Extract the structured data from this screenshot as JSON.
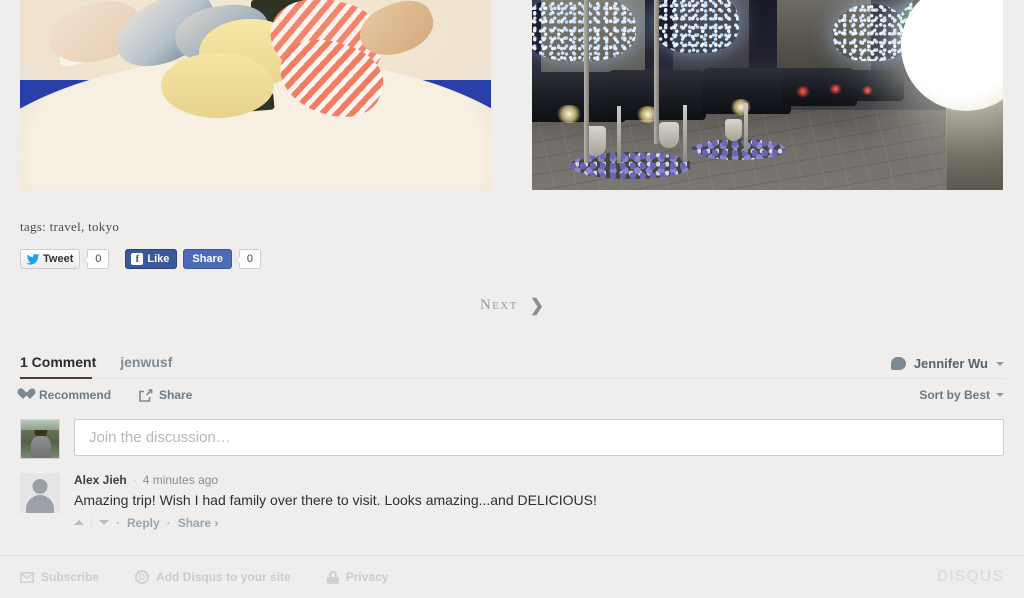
{
  "gallery": {
    "images": [
      {
        "alt": "Sushi platter on blue-and-white patterned plate",
        "name": "photo-sushi"
      },
      {
        "alt": "Tokyo street at night with illuminated trees and taxis",
        "name": "photo-street"
      }
    ]
  },
  "tags": {
    "label": "tags: travel, tokyo"
  },
  "social": {
    "tweet_label": "Tweet",
    "tweet_count": "0",
    "like_label": "Like",
    "facebook_glyph": "f",
    "share_label": "Share",
    "share_count": "0"
  },
  "pagination": {
    "next_label": "Next",
    "next_chevron": "❯"
  },
  "disqus": {
    "tabs": [
      {
        "label": "1 Comment",
        "active": true
      },
      {
        "label": "jenwusf",
        "active": false
      }
    ],
    "user": {
      "name": "Jennifer Wu",
      "icon": "speech-bubble-icon"
    },
    "actions": {
      "recommend_label": "Recommend",
      "share_label": "Share",
      "sort_label": "Sort by Best"
    },
    "compose": {
      "placeholder": "Join the discussion…",
      "value": ""
    },
    "comments": [
      {
        "author": "Alex Jieh",
        "separator": "·",
        "time": "4 minutes ago",
        "text": "Amazing trip! Wish I had family over there to visit. Looks amazing...and DELICIOUS!",
        "reply_label": "Reply",
        "share_label": "Share ›",
        "dot": "·"
      }
    ],
    "footer": {
      "subscribe_label": "Subscribe",
      "add_disqus_label": "Add Disqus to your site",
      "privacy_label": "Privacy",
      "disqus_d": "D",
      "logo": "DISQUS"
    }
  },
  "colors": {
    "page_background": "#efeeed",
    "facebook_blue": "#3b5998",
    "facebook_share_blue": "#4c69ba",
    "twitter_blue": "#1da1f2",
    "active_tab_underline": "#5b3a2e",
    "muted_text": "#7f8c96",
    "footer_text": "#c7ccd0"
  }
}
